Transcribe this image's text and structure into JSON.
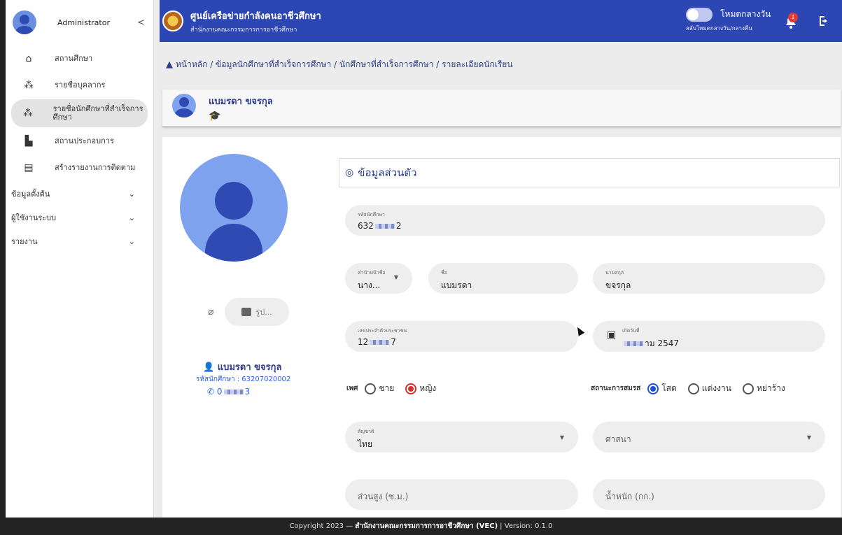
{
  "sidebar": {
    "title": "Administrator",
    "collapse_icon": "<",
    "items": [
      {
        "label": "สถานศึกษา",
        "icon": "school-icon"
      },
      {
        "label": "รายชื่อบุคลากร",
        "icon": "people-icon"
      },
      {
        "label": "รายชื่อนักศึกษาที่สำเร็จการศึกษา",
        "icon": "graduates-icon"
      },
      {
        "label": "สถานประกอบการ",
        "icon": "factory-icon"
      },
      {
        "label": "สร้างรายงานการติดตาม",
        "icon": "document-icon"
      }
    ],
    "groups": [
      "ข้อมูลตั้งต้น",
      "ผู้ใช้งานระบบ",
      "รายงาน"
    ]
  },
  "topbar": {
    "title": "ศูนย์เครือข่ายกำลังคนอาชีวศึกษา",
    "subtitle": "สำนักงานคณะกรรมการการอาชีวศึกษา",
    "mode_label": "โหมดกลางวัน",
    "mode_sub": "สลับโหมดกลางวัน/กลางคืน",
    "notif_count": "1"
  },
  "breadcrumb": "หน้าหลัก / ข้อมูลนักศึกษาที่สำเร็จการศึกษา / นักศึกษาที่สำเร็จการศึกษา / รายละเอียดนักเรียน",
  "student": {
    "name": "แบมรดา ขจรกุล",
    "id_text": "รหัสนักศึกษา : 63207020002",
    "phone_prefix": "0",
    "phone_suffix": "3"
  },
  "upload_label": "รูป...",
  "section_title": "ข้อมูลส่วนตัว",
  "fields": {
    "student_id": {
      "label": "รหัสนักศึกษา",
      "value_prefix": "632",
      "value_suffix": "2"
    },
    "prefix": {
      "label": "คำนำหน้าชื่อ",
      "value": "นาง..."
    },
    "first_name": {
      "label": "ชื่อ",
      "value": "แบมรดา"
    },
    "last_name": {
      "label": "นามสกุล",
      "value": "ขจรกุล"
    },
    "citizen_id": {
      "label": "เลขประจำตัวประชาชน",
      "value_prefix": "12",
      "value_suffix": "7"
    },
    "birth_date": {
      "label": "เกิดวันที่",
      "value_suffix": "าม 2547"
    },
    "nationality": {
      "label": "สัญชาติ",
      "value": "ไทย"
    },
    "religion": {
      "placeholder": "ศาสนา"
    },
    "height": {
      "placeholder": "ส่วนสูง (ซ.ม.)"
    },
    "weight": {
      "placeholder": "น้ำหนัก (กก.)"
    }
  },
  "gender": {
    "label": "เพศ",
    "options": [
      "ชาย",
      "หญิง"
    ],
    "selected": "หญิง"
  },
  "marital": {
    "label": "สถานะการสมรส",
    "options": [
      "โสด",
      "แต่งงาน",
      "หย่าร้าง"
    ],
    "selected": "โสด"
  },
  "footer": {
    "copyright": "Copyright 2023 —",
    "org": "สำนักงานคณะกรรมการการอาชีวศึกษา (VEC)",
    "version": "| Version: 0.1.0"
  }
}
